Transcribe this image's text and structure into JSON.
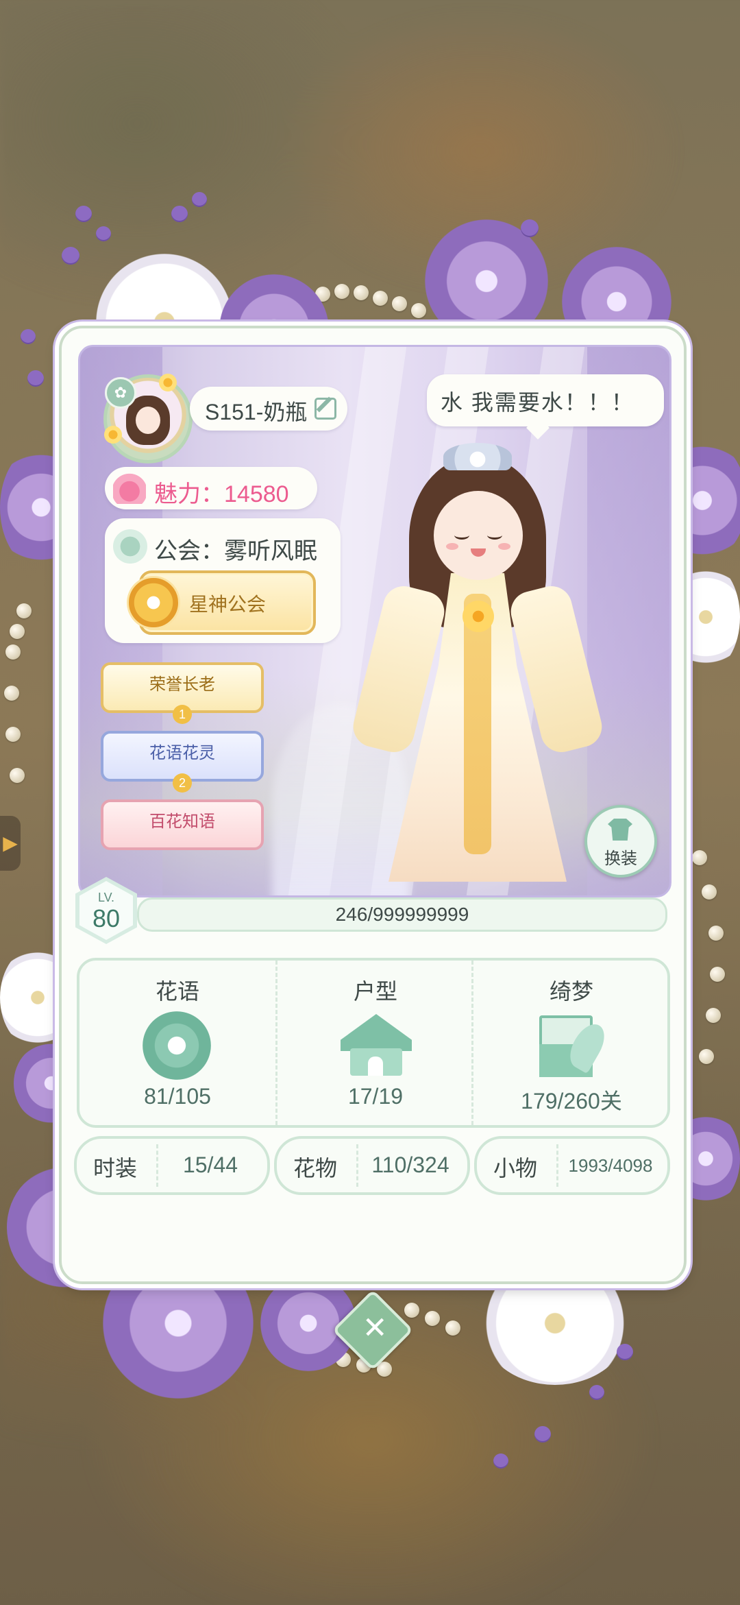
{
  "profile": {
    "name": "S151-奶瓶",
    "charm_text": "魅力：14580",
    "guild_text": "公会：雾听风眠",
    "guild_plaque": "星神公会",
    "speech": "水 我需要水！！！"
  },
  "titles": [
    {
      "label": "荣誉长老",
      "num": "1"
    },
    {
      "label": "花语花灵",
      "num": "2"
    },
    {
      "label": "百花知语",
      "num": ""
    }
  ],
  "outfit_button": "换装",
  "level": {
    "label": "LV.",
    "value": "80",
    "exp_text": "246/999999999",
    "exp_fraction": 2e-07
  },
  "stats": [
    {
      "title": "花语",
      "value": "81/105",
      "icon": "flower-icon"
    },
    {
      "title": "户型",
      "value": "17/19",
      "icon": "house-icon"
    },
    {
      "title": "绮梦",
      "value": "179/260关",
      "icon": "letter-feather-icon"
    }
  ],
  "collections": [
    {
      "label": "时装",
      "value": "15/44"
    },
    {
      "label": "花物",
      "value": "110/324"
    },
    {
      "label": "小物",
      "value": "1993/4098"
    }
  ],
  "close_icon": "close-icon",
  "colors": {
    "accent_green": "#7ec0a6",
    "charm_pink": "#ec5b8f",
    "frame_purple": "#c9b9e6"
  }
}
